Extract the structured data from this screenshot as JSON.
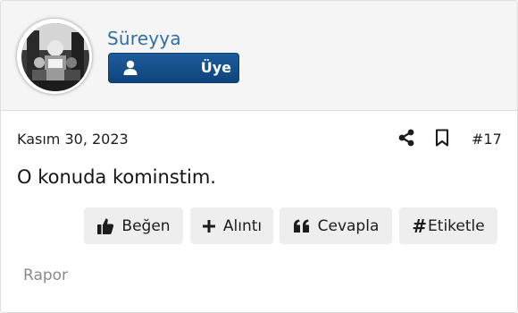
{
  "user": {
    "name": "Süreyya",
    "role": "Üye"
  },
  "post": {
    "date": "Kasım 30, 2023",
    "number": "#17",
    "body": "O konuda kominstim."
  },
  "actions": {
    "like": "Beğen",
    "quote": "Alıntı",
    "reply": "Cevapla",
    "tag_hash": "#",
    "tag": "Etiketle"
  },
  "footer": {
    "report": "Rapor"
  },
  "icons": {
    "role": "person-icon",
    "share": "share-icon",
    "bookmark": "bookmark-icon",
    "like": "thumbs-up-icon",
    "quote": "plus-icon",
    "reply": "quote-marks-icon"
  },
  "colors": {
    "username": "#2f6fa8",
    "badge": "#134b86",
    "button_bg": "#eeeeee"
  }
}
